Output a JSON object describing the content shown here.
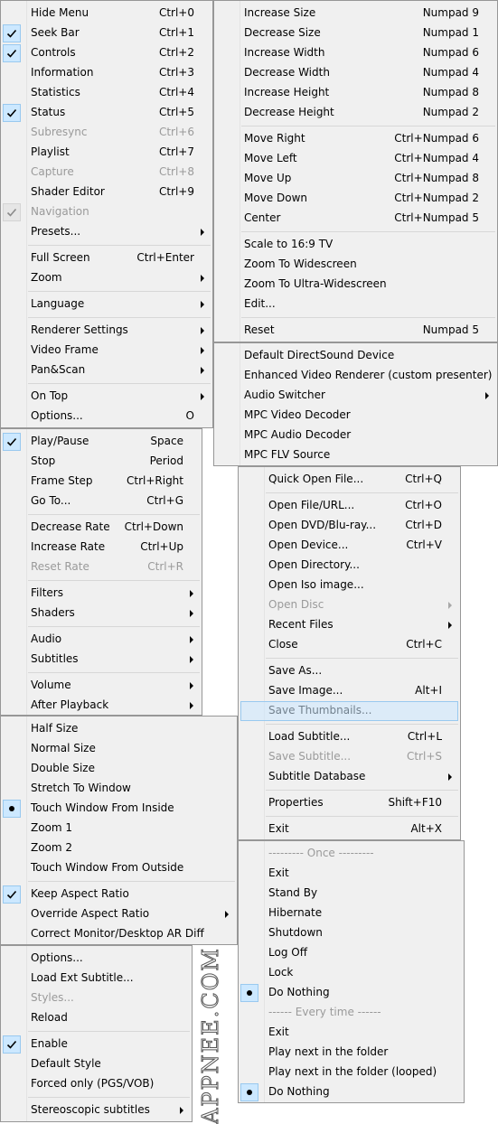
{
  "menus": {
    "view": [
      {
        "label": "Hide Menu",
        "shortcut": "Ctrl+0"
      },
      {
        "label": "Seek Bar",
        "shortcut": "Ctrl+1",
        "check": "check"
      },
      {
        "label": "Controls",
        "shortcut": "Ctrl+2",
        "check": "check"
      },
      {
        "label": "Information",
        "shortcut": "Ctrl+3"
      },
      {
        "label": "Statistics",
        "shortcut": "Ctrl+4"
      },
      {
        "label": "Status",
        "shortcut": "Ctrl+5",
        "check": "check"
      },
      {
        "label": "Subresync",
        "shortcut": "Ctrl+6",
        "disabled": true
      },
      {
        "label": "Playlist",
        "shortcut": "Ctrl+7"
      },
      {
        "label": "Capture",
        "shortcut": "Ctrl+8",
        "disabled": true
      },
      {
        "label": "Shader Editor",
        "shortcut": "Ctrl+9"
      },
      {
        "label": "Navigation",
        "check": "check",
        "disabled": true
      },
      {
        "label": "Presets...",
        "submenu": true
      },
      {
        "sep": true
      },
      {
        "label": "Full Screen",
        "shortcut": "Ctrl+Enter"
      },
      {
        "label": "Zoom",
        "submenu": true
      },
      {
        "sep": true
      },
      {
        "label": "Language",
        "submenu": true
      },
      {
        "sep": true
      },
      {
        "label": "Renderer Settings",
        "submenu": true
      },
      {
        "label": "Video Frame",
        "submenu": true
      },
      {
        "label": "Pan&Scan",
        "submenu": true
      },
      {
        "sep": true
      },
      {
        "label": "On Top",
        "submenu": true
      },
      {
        "label": "Options...",
        "shortcut": "O"
      }
    ],
    "panscan": [
      {
        "label": "Increase Size",
        "shortcut": "Numpad 9"
      },
      {
        "label": "Decrease Size",
        "shortcut": "Numpad 1"
      },
      {
        "label": "Increase Width",
        "shortcut": "Numpad 6"
      },
      {
        "label": "Decrease Width",
        "shortcut": "Numpad 4"
      },
      {
        "label": "Increase Height",
        "shortcut": "Numpad 8"
      },
      {
        "label": "Decrease Height",
        "shortcut": "Numpad 2"
      },
      {
        "sep": true
      },
      {
        "label": "Move Right",
        "shortcut": "Ctrl+Numpad 6"
      },
      {
        "label": "Move Left",
        "shortcut": "Ctrl+Numpad 4"
      },
      {
        "label": "Move Up",
        "shortcut": "Ctrl+Numpad 8"
      },
      {
        "label": "Move Down",
        "shortcut": "Ctrl+Numpad 2"
      },
      {
        "label": "Center",
        "shortcut": "Ctrl+Numpad 5"
      },
      {
        "sep": true
      },
      {
        "label": "Scale to 16:9 TV"
      },
      {
        "label": "Zoom To Widescreen"
      },
      {
        "label": "Zoom To Ultra-Widescreen"
      },
      {
        "label": "Edit..."
      },
      {
        "sep": true
      },
      {
        "label": "Reset",
        "shortcut": "Numpad 5"
      }
    ],
    "filters": [
      {
        "label": "Default DirectSound Device"
      },
      {
        "label": "Enhanced Video Renderer (custom presenter)"
      },
      {
        "label": "Audio Switcher",
        "submenu": true
      },
      {
        "label": "MPC Video Decoder"
      },
      {
        "label": "MPC Audio Decoder"
      },
      {
        "label": "MPC FLV Source"
      }
    ],
    "play": [
      {
        "label": "Play/Pause",
        "shortcut": "Space",
        "check": "check"
      },
      {
        "label": "Stop",
        "shortcut": "Period"
      },
      {
        "label": "Frame Step",
        "shortcut": "Ctrl+Right"
      },
      {
        "label": "Go To...",
        "shortcut": "Ctrl+G"
      },
      {
        "sep": true
      },
      {
        "label": "Decrease Rate",
        "shortcut": "Ctrl+Down"
      },
      {
        "label": "Increase Rate",
        "shortcut": "Ctrl+Up"
      },
      {
        "label": "Reset Rate",
        "shortcut": "Ctrl+R",
        "disabled": true
      },
      {
        "sep": true
      },
      {
        "label": "Filters",
        "submenu": true
      },
      {
        "label": "Shaders",
        "submenu": true
      },
      {
        "sep": true
      },
      {
        "label": "Audio",
        "submenu": true
      },
      {
        "label": "Subtitles",
        "submenu": true
      },
      {
        "sep": true
      },
      {
        "label": "Volume",
        "submenu": true
      },
      {
        "label": "After Playback",
        "submenu": true
      }
    ],
    "file": [
      {
        "label": "Quick Open File...",
        "shortcut": "Ctrl+Q"
      },
      {
        "sep": true
      },
      {
        "label": "Open File/URL...",
        "shortcut": "Ctrl+O"
      },
      {
        "label": "Open DVD/Blu-ray...",
        "shortcut": "Ctrl+D"
      },
      {
        "label": "Open Device...",
        "shortcut": "Ctrl+V"
      },
      {
        "label": "Open Directory..."
      },
      {
        "label": "Open Iso image..."
      },
      {
        "label": "Open Disc",
        "submenu": true,
        "disabled": true
      },
      {
        "label": "Recent Files",
        "submenu": true
      },
      {
        "label": "Close",
        "shortcut": "Ctrl+C"
      },
      {
        "sep": true
      },
      {
        "label": "Save As..."
      },
      {
        "label": "Save Image...",
        "shortcut": "Alt+I"
      },
      {
        "label": "Save Thumbnails...",
        "highlight": true
      },
      {
        "sep": true
      },
      {
        "label": "Load Subtitle...",
        "shortcut": "Ctrl+L"
      },
      {
        "label": "Save Subtitle...",
        "shortcut": "Ctrl+S",
        "disabled": true
      },
      {
        "label": "Subtitle Database",
        "submenu": true
      },
      {
        "sep": true
      },
      {
        "label": "Properties",
        "shortcut": "Shift+F10"
      },
      {
        "sep": true
      },
      {
        "label": "Exit",
        "shortcut": "Alt+X"
      }
    ],
    "video_frame": [
      {
        "label": "Half Size"
      },
      {
        "label": "Normal Size"
      },
      {
        "label": "Double Size"
      },
      {
        "label": "Stretch To Window"
      },
      {
        "label": "Touch Window From Inside",
        "check": "dot"
      },
      {
        "label": "Zoom 1"
      },
      {
        "label": "Zoom 2"
      },
      {
        "label": "Touch Window From Outside"
      },
      {
        "sep": true
      },
      {
        "label": "Keep Aspect Ratio",
        "check": "check"
      },
      {
        "label": "Override Aspect Ratio",
        "submenu": true
      },
      {
        "label": "Correct Monitor/Desktop AR Diff"
      }
    ],
    "after_playback": [
      {
        "label": "--------- Once ---------",
        "disabled": true
      },
      {
        "label": "Exit"
      },
      {
        "label": "Stand By"
      },
      {
        "label": "Hibernate"
      },
      {
        "label": "Shutdown"
      },
      {
        "label": "Log Off"
      },
      {
        "label": "Lock"
      },
      {
        "label": "Do Nothing",
        "check": "dot"
      },
      {
        "label": "------ Every time ------",
        "disabled": true
      },
      {
        "label": "Exit"
      },
      {
        "label": "Play next in the folder"
      },
      {
        "label": "Play next in the folder (looped)"
      },
      {
        "label": "Do Nothing",
        "check": "dot"
      }
    ],
    "subtitles": [
      {
        "label": "Options..."
      },
      {
        "label": "Load Ext Subtitle..."
      },
      {
        "label": "Styles...",
        "disabled": true
      },
      {
        "label": "Reload"
      },
      {
        "sep": true
      },
      {
        "label": "Enable",
        "check": "check"
      },
      {
        "label": "Default Style"
      },
      {
        "label": "Forced only (PGS/VOB)"
      },
      {
        "sep": true
      },
      {
        "label": "Stereoscopic subtitles",
        "submenu": true
      }
    ]
  },
  "watermark": "APPNEE.COM",
  "colors": {
    "menu_bg": "#f0f0f0",
    "check_bg": "#cce8ff",
    "check_border": "#99c9ef",
    "disabled_text": "#9a9a9a"
  }
}
